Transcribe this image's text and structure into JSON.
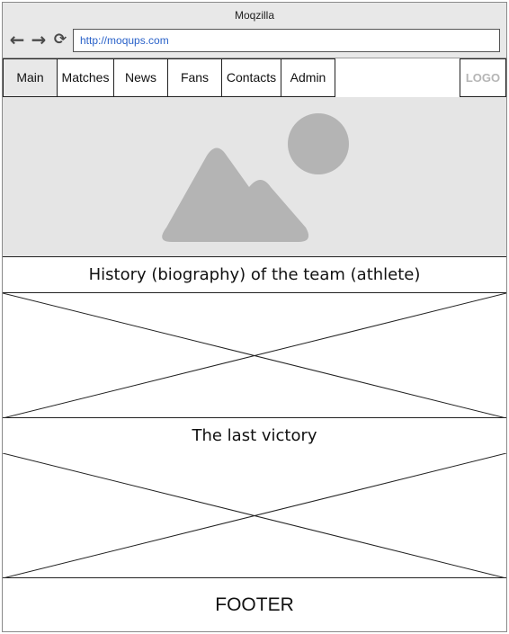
{
  "browser": {
    "title": "Moqzilla",
    "url": "http://moqups.com",
    "icons": {
      "back": "arrow-left-icon",
      "forward": "arrow-right-icon",
      "reload": "reload-icon"
    }
  },
  "menu": {
    "items": [
      {
        "label": "Main"
      },
      {
        "label": "Matches"
      },
      {
        "label": "News"
      },
      {
        "label": "Fans"
      },
      {
        "label": "Contacts"
      },
      {
        "label": "Admin"
      }
    ],
    "logo": "LOGO"
  },
  "hero": {
    "icon": "image-placeholder-icon"
  },
  "sections": {
    "history_title": "History (biography) of the team (athlete)",
    "victory_title": "The last victory"
  },
  "footer": {
    "label": "FOOTER"
  },
  "colors": {
    "chrome_bg": "#e8e8e8",
    "hero_bg": "#e5e5e5",
    "placeholder_gray": "#b4b4b4",
    "url_text": "#2a62c9",
    "logo_text": "#b5b5b5"
  }
}
